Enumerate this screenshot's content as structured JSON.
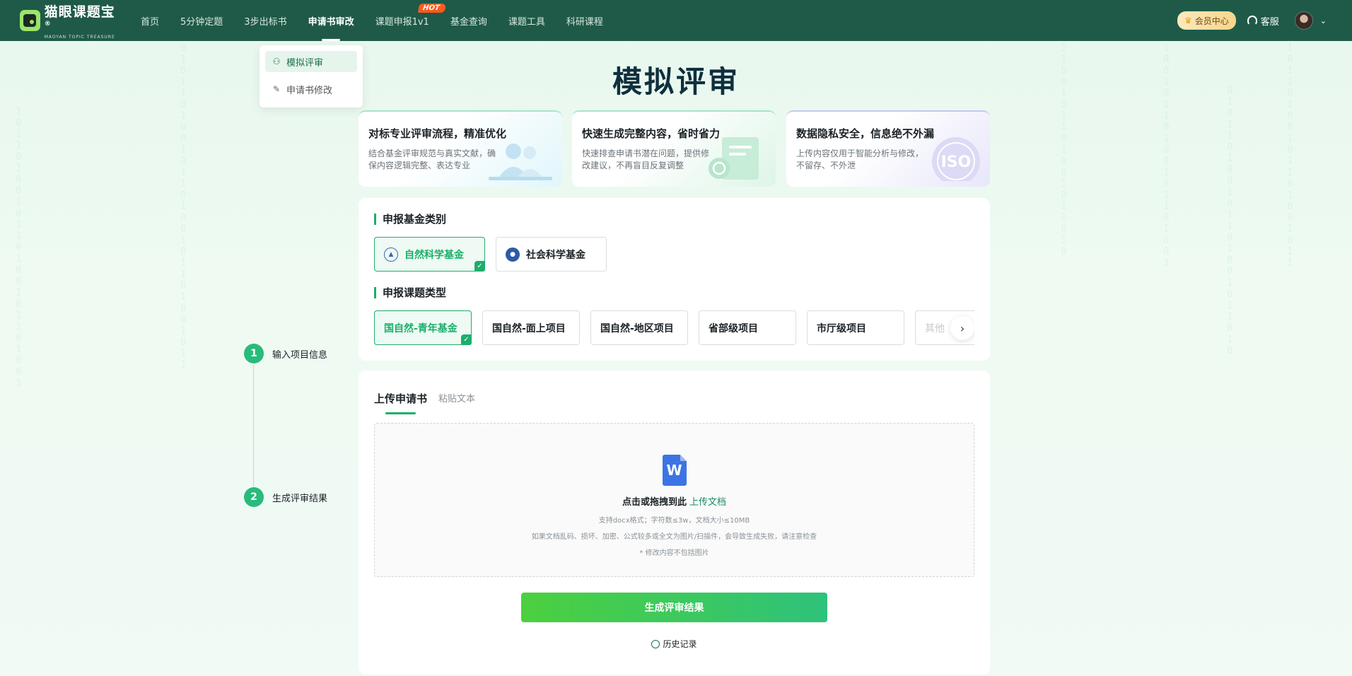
{
  "header": {
    "logo_text": "猫眼课题宝",
    "logo_sub": "MAOYAN TOPIC TREASURE",
    "logo_reg": "®",
    "nav": [
      {
        "label": "首页"
      },
      {
        "label": "5分钟定题"
      },
      {
        "label": "3步出标书"
      },
      {
        "label": "申请书审改",
        "active": true
      },
      {
        "label": "课题申报1v1",
        "badge": "HOT"
      },
      {
        "label": "基金查询"
      },
      {
        "label": "课题工具"
      },
      {
        "label": "科研课程"
      }
    ],
    "vip_label": "会员中心",
    "service_label": "客服"
  },
  "dropdown": {
    "items": [
      {
        "label": "模拟评审",
        "icon": "user-review-icon",
        "selected": true
      },
      {
        "label": "申请书修改",
        "icon": "edit-pen-icon"
      }
    ]
  },
  "page": {
    "title": "模拟评审"
  },
  "features": [
    {
      "title": "对标专业评审流程，精准优化",
      "desc": "结合基金评审规范与真实文献，确保内容逻辑完整、表达专业",
      "icon": "reviewers-illustration"
    },
    {
      "title": "快速生成完整内容，省时省力",
      "desc": "快速排查申请书潜在问题，提供修改建议，不再盲目反复调整",
      "icon": "document-refresh-illustration"
    },
    {
      "title": "数据隐私安全，信息绝不外漏",
      "desc": "上传内容仅用于智能分析与修改，不留存、不外泄",
      "icon": "iso-seal-illustration"
    }
  ],
  "fund_section": {
    "title": "申报基金类别",
    "options": [
      {
        "label": "自然科学基金",
        "selected": true
      },
      {
        "label": "社会科学基金"
      }
    ]
  },
  "type_section": {
    "title": "申报课题类型",
    "options": [
      {
        "label": "国自然-青年基金",
        "selected": true
      },
      {
        "label": "国自然-面上项目"
      },
      {
        "label": "国自然-地区项目"
      },
      {
        "label": "省部级项目"
      },
      {
        "label": "市厅级项目"
      },
      {
        "label": "其他"
      }
    ]
  },
  "steps": [
    {
      "num": "1",
      "label": "输入项目信息"
    },
    {
      "num": "2",
      "label": "生成评审结果"
    }
  ],
  "upload": {
    "tab_upload": "上传申请书",
    "tab_paste": "粘贴文本",
    "main_text": "点击或拖拽到此",
    "main_link": "上传文档",
    "hint1": "支持docx格式；字符数≤3w，文档大小≤10MB",
    "hint2": "如果文档乱码、损坏、加密、公式较多或全文为图片/扫描件，会导致生成失败，请注意检查",
    "hint3": "* 修改内容不包括图片",
    "generate_button": "生成评审结果",
    "history_label": "历史记录"
  },
  "colors": {
    "nav_bg": "#1f5a48",
    "accent": "#1cae6b",
    "button_start": "#4cd03f",
    "button_end": "#2ec27b"
  }
}
